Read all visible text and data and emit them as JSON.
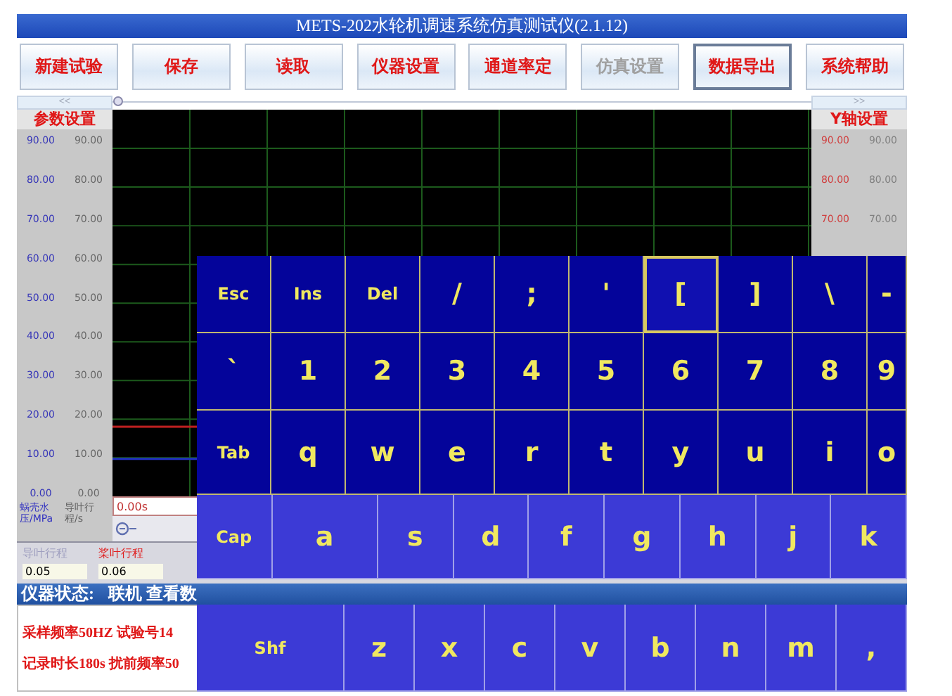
{
  "window": {
    "title": "METS-202水轮机调速系统仿真测试仪(2.1.12)"
  },
  "toolbar": [
    {
      "label": "新建试验",
      "disabled": false,
      "selected": false
    },
    {
      "label": "保存",
      "disabled": false,
      "selected": false
    },
    {
      "label": "读取",
      "disabled": false,
      "selected": false
    },
    {
      "label": "仪器设置",
      "disabled": false,
      "selected": false
    },
    {
      "label": "通道率定",
      "disabled": false,
      "selected": false
    },
    {
      "label": "仿真设置",
      "disabled": true,
      "selected": false
    },
    {
      "label": "数据导出",
      "disabled": false,
      "selected": true
    },
    {
      "label": "系统帮助",
      "disabled": false,
      "selected": false
    }
  ],
  "scroll": {
    "left": "<<",
    "right": ">>"
  },
  "left_panel": {
    "title": "参数设置",
    "column_1": [
      "90.00",
      "80.00",
      "70.00",
      "60.00",
      "50.00",
      "40.00",
      "30.00",
      "20.00",
      "10.00",
      "0.00"
    ],
    "column_2": [
      "90.00",
      "80.00",
      "70.00",
      "60.00",
      "50.00",
      "40.00",
      "30.00",
      "20.00",
      "10.00",
      "0.00"
    ],
    "axis_labels": [
      "蜗壳水压/MPa",
      "导叶行程/s"
    ]
  },
  "right_panel": {
    "title": "Y轴设置",
    "column_1": [
      "90.00",
      "80.00",
      "70.00"
    ],
    "column_2": [
      "90.00",
      "80.00",
      "70.00"
    ]
  },
  "time_axis": [
    "0.00s"
  ],
  "params": [
    {
      "label": "导叶行程",
      "color": "#a0a0c0",
      "value": "0.05"
    },
    {
      "label": "桨叶行程",
      "color": "#e02020",
      "value": "0.06"
    }
  ],
  "status_bar": {
    "label": "仪器状态:",
    "value": "联机 查看数"
  },
  "info": [
    "采样频率50HZ 试验号14",
    "记录时长180s 扰前频率50"
  ],
  "keyboard": [
    {
      "kind": "dark",
      "keys": [
        {
          "label": "Esc",
          "selected": false
        },
        {
          "label": "Ins",
          "selected": false
        },
        {
          "label": "Del",
          "selected": false
        },
        {
          "label": "/",
          "selected": false
        },
        {
          "label": ";",
          "selected": false
        },
        {
          "label": "'",
          "selected": false
        },
        {
          "label": "[",
          "selected": true
        },
        {
          "label": "]",
          "selected": false
        },
        {
          "label": "\\",
          "selected": false
        },
        {
          "label": "-",
          "selected": false
        }
      ]
    },
    {
      "kind": "dark",
      "keys": [
        {
          "label": "`",
          "selected": false
        },
        {
          "label": "1",
          "selected": false
        },
        {
          "label": "2",
          "selected": false
        },
        {
          "label": "3",
          "selected": false
        },
        {
          "label": "4",
          "selected": false
        },
        {
          "label": "5",
          "selected": false
        },
        {
          "label": "6",
          "selected": false
        },
        {
          "label": "7",
          "selected": false
        },
        {
          "label": "8",
          "selected": false
        },
        {
          "label": "9",
          "selected": false
        }
      ]
    },
    {
      "kind": "dark",
      "keys": [
        {
          "label": "Tab",
          "selected": false
        },
        {
          "label": "q",
          "selected": false
        },
        {
          "label": "w",
          "selected": false
        },
        {
          "label": "e",
          "selected": false
        },
        {
          "label": "r",
          "selected": false
        },
        {
          "label": "t",
          "selected": false
        },
        {
          "label": "y",
          "selected": false
        },
        {
          "label": "u",
          "selected": false
        },
        {
          "label": "i",
          "selected": false
        },
        {
          "label": "o",
          "selected": false
        }
      ]
    },
    {
      "kind": "light",
      "keys": [
        {
          "label": "Cap",
          "selected": false
        },
        {
          "label": "a",
          "selected": false
        },
        {
          "label": "s",
          "selected": false
        },
        {
          "label": "d",
          "selected": false
        },
        {
          "label": "f",
          "selected": false
        },
        {
          "label": "g",
          "selected": false
        },
        {
          "label": "h",
          "selected": false
        },
        {
          "label": "j",
          "selected": false
        },
        {
          "label": "k",
          "selected": false
        }
      ]
    },
    {
      "kind": "light",
      "keys": [
        {
          "label": "Shf",
          "selected": false
        },
        {
          "label": "z",
          "selected": false
        },
        {
          "label": "x",
          "selected": false
        },
        {
          "label": "c",
          "selected": false
        },
        {
          "label": "v",
          "selected": false
        },
        {
          "label": "b",
          "selected": false
        },
        {
          "label": "n",
          "selected": false
        },
        {
          "label": "m",
          "selected": false
        },
        {
          "label": ",",
          "selected": false
        }
      ]
    }
  ]
}
